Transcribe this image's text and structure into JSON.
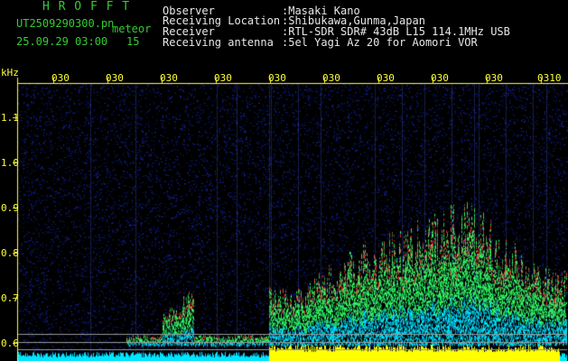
{
  "header": {
    "logo": "H R O F F T",
    "filename": "UT2509290300.pn",
    "type_label": "meteor",
    "datetime": "25.09.29 03:00",
    "count": "15",
    "observer_label": "Observer",
    "observer_value": ":Masaki Kano",
    "location_label": "Receiving Location",
    "location_value": ":Shibukawa,Gunma,Japan",
    "receiver_label": "Receiver",
    "receiver_value": ":RTL-SDR SDR# 43dB L15 114.1MHz USB",
    "antenna_label": "Receiving antenna",
    "antenna_value": ":5el Yagi Az 20 for Aomori VOR"
  },
  "spectrogram": {
    "unit_label": "kHz",
    "y_ticks": [
      "1.1",
      "1.0",
      "0.9",
      "0.8",
      "0.7",
      "0.6"
    ],
    "x_ticks": [
      "030",
      "030",
      "030",
      "030",
      "030",
      "030",
      "030",
      "030",
      "030",
      "0310"
    ],
    "ylim": [
      0.56,
      1.2
    ],
    "colors": {
      "background": "#000000",
      "noise": "#0a1a7a",
      "signal_low": "#00e5ff",
      "signal_mid": "#33ff66",
      "signal_high": "#ff3333",
      "noise_band": "#ffff00",
      "axis": "#ffff33"
    }
  }
}
